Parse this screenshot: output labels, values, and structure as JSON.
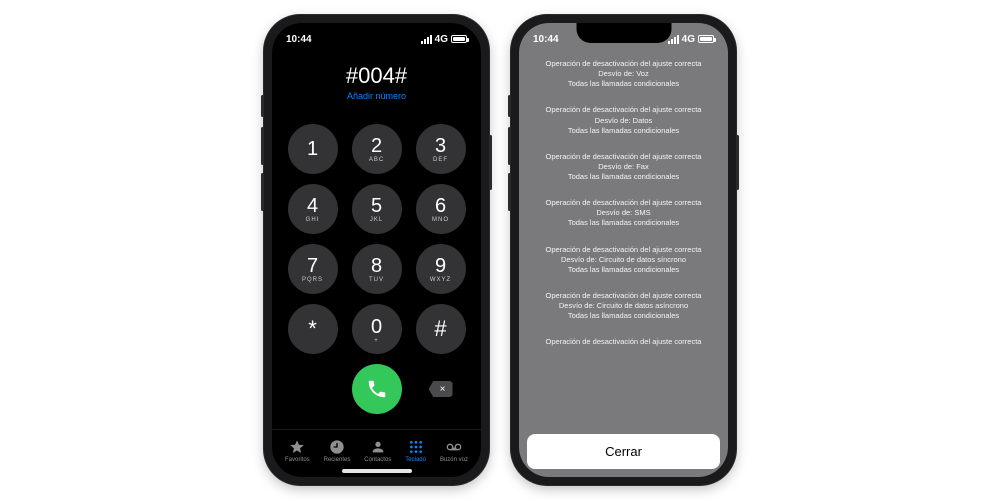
{
  "status": {
    "time": "10:44",
    "network": "4G"
  },
  "dialer": {
    "entered": "#004#",
    "add_number": "Añadir número",
    "keys": [
      {
        "d": "1",
        "l": ""
      },
      {
        "d": "2",
        "l": "ABC"
      },
      {
        "d": "3",
        "l": "DEF"
      },
      {
        "d": "4",
        "l": "GHI"
      },
      {
        "d": "5",
        "l": "JKL"
      },
      {
        "d": "6",
        "l": "MNO"
      },
      {
        "d": "7",
        "l": "PQRS"
      },
      {
        "d": "8",
        "l": "TUV"
      },
      {
        "d": "9",
        "l": "WXYZ"
      },
      {
        "d": "*",
        "l": ""
      },
      {
        "d": "0",
        "l": "+"
      },
      {
        "d": "#",
        "l": ""
      }
    ],
    "tabs": {
      "favorites": "Favoritos",
      "recents": "Recientes",
      "contacts": "Contactos",
      "keypad": "Teclado",
      "voicemail": "Buzón voz"
    },
    "delete_glyph": "×"
  },
  "result": {
    "blocks": [
      {
        "l1": "Operación de desactivación del ajuste correcta",
        "l2": "Desvío de: Voz",
        "l3": "Todas las llamadas condicionales"
      },
      {
        "l1": "Operación de desactivación del ajuste correcta",
        "l2": "Desvío de: Datos",
        "l3": "Todas las llamadas condicionales"
      },
      {
        "l1": "Operación de desactivación del ajuste correcta",
        "l2": "Desvío de: Fax",
        "l3": "Todas las llamadas condicionales"
      },
      {
        "l1": "Operación de desactivación del ajuste correcta",
        "l2": "Desvío de: SMS",
        "l3": "Todas las llamadas condicionales"
      },
      {
        "l1": "Operación de desactivación del ajuste correcta",
        "l2": "Desvío de: Circuito de datos síncrono",
        "l3": "Todas las llamadas condicionales"
      },
      {
        "l1": "Operación de desactivación del ajuste correcta",
        "l2": "Desvío de: Circuito de datos asíncrono",
        "l3": "Todas las llamadas condicionales"
      },
      {
        "l1": "Operación de desactivación del ajuste correcta",
        "l2": "",
        "l3": ""
      }
    ],
    "close": "Cerrar"
  }
}
